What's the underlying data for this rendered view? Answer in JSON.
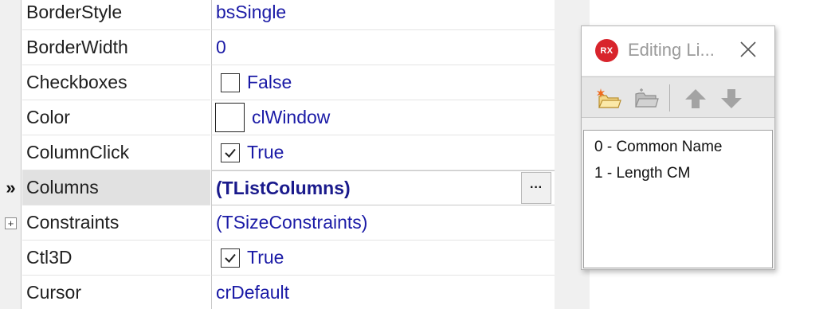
{
  "inspector": {
    "rows": [
      {
        "name": "BorderStyle",
        "value": "bsSingle"
      },
      {
        "name": "BorderWidth",
        "value": "0"
      },
      {
        "name": "Checkboxes",
        "value": "False",
        "checked": false
      },
      {
        "name": "Color",
        "value": "clWindow",
        "swatch_color": "#ffffff"
      },
      {
        "name": "ColumnClick",
        "value": "True",
        "checked": true
      },
      {
        "name": "Columns",
        "value": "(TListColumns)",
        "selected_marker": "»",
        "ellipsis": "···"
      },
      {
        "name": "Constraints",
        "value": "(TSizeConstraints)",
        "expand": "+"
      },
      {
        "name": "Ctl3D",
        "value": "True",
        "checked": true
      },
      {
        "name": "Cursor",
        "value": "crDefault"
      }
    ]
  },
  "editor": {
    "logo_text": "RX",
    "title": "Editing Li...",
    "toolbar": [
      "add-item-icon",
      "delete-item-icon",
      "move-up-icon",
      "move-down-icon"
    ],
    "items": [
      "0 - Common Name",
      "1 - Length CM"
    ]
  },
  "colors": {
    "value_text": "#1a1aa6",
    "selected_name_bg": "#e1e1e1",
    "logo_red": "#d8242c"
  }
}
